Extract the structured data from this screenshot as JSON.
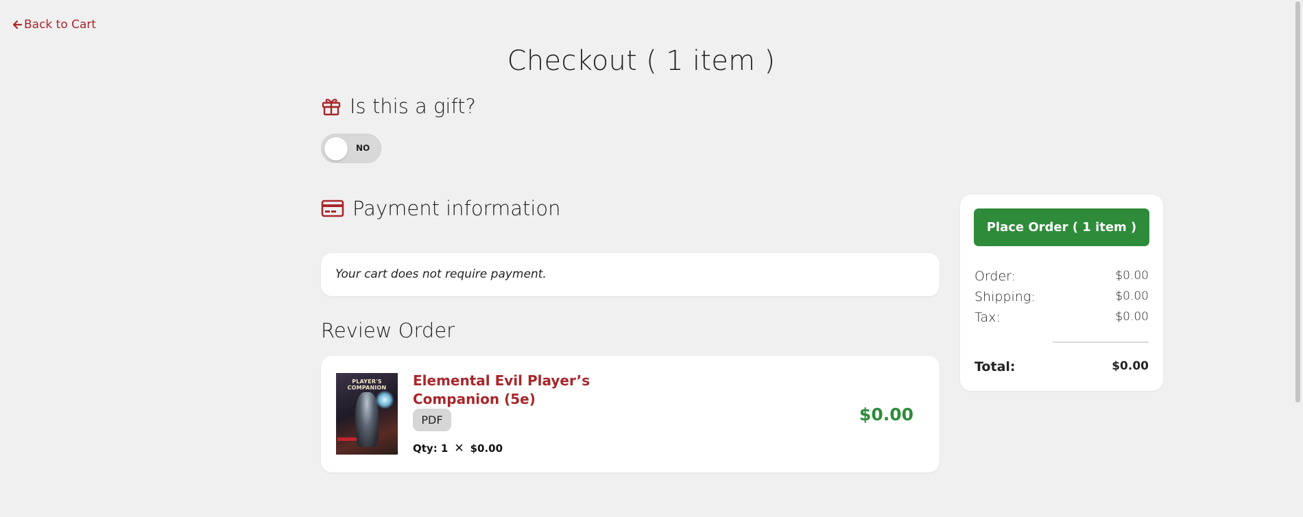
{
  "nav": {
    "back_label": "Back to Cart"
  },
  "page": {
    "title": "Checkout ( 1 item )"
  },
  "gift": {
    "heading": "Is this a gift?",
    "toggle_label": "NO",
    "toggle_on": false
  },
  "payment": {
    "heading": "Payment information",
    "note": "Your cart does not require payment."
  },
  "review": {
    "heading": "Review Order",
    "item": {
      "name": "Elemental Evil Player’s Companion (5e)",
      "cover_text": "PLAYER'S COMPANION",
      "format": "PDF",
      "qty_label": "Qty: 1",
      "unit_price": "$0.00",
      "line_total": "$0.00"
    }
  },
  "summary": {
    "place_order_label": "Place Order ( 1 item )",
    "order_label": "Order:",
    "order_value": "$0.00",
    "shipping_label": "Shipping:",
    "shipping_value": "$0.00",
    "tax_label": "Tax:",
    "tax_value": "$0.00",
    "total_label": "Total:",
    "total_value": "$0.00"
  },
  "colors": {
    "accent": "#a8262b",
    "success": "#2e8b3a",
    "background": "#f0f0f0"
  },
  "icons": [
    "arrow-left-icon",
    "gift-icon",
    "credit-card-icon",
    "close-icon"
  ]
}
